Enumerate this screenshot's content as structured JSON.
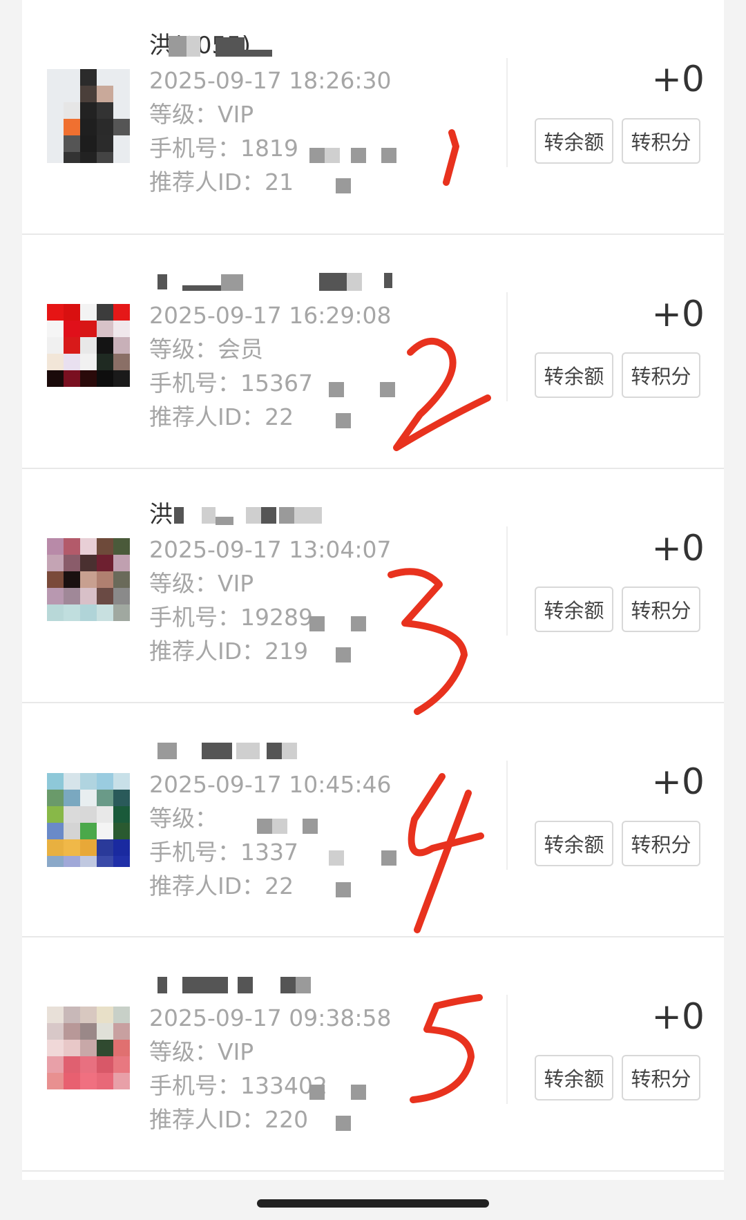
{
  "items": [
    {
      "name": "洪(0055)",
      "time": "2025-09-17 18:26:30",
      "level": "等级：VIP",
      "phone": "手机号：1819",
      "referrer": "推荐人ID：21",
      "amount": "+0",
      "btn_balance": "转余额",
      "btn_points": "转积分"
    },
    {
      "name": "",
      "time": "2025-09-17 16:29:08",
      "level": "等级：会员",
      "phone": "手机号：15367",
      "referrer": "推荐人ID：22",
      "amount": "+0",
      "btn_balance": "转余额",
      "btn_points": "转积分"
    },
    {
      "name": "洪",
      "time": "2025-09-17 13:04:07",
      "level": "等级：VIP",
      "phone": "手机号：19289",
      "referrer": "推荐人ID：219",
      "amount": "+0",
      "btn_balance": "转余额",
      "btn_points": "转积分"
    },
    {
      "name": "",
      "time": "2025-09-17 10:45:46",
      "level": "等级：",
      "phone": "手机号：1337",
      "referrer": "推荐人ID：22",
      "amount": "+0",
      "btn_balance": "转余额",
      "btn_points": "转积分"
    },
    {
      "name": "",
      "time": "2025-09-17 09:38:58",
      "level": "等级：VIP",
      "phone": "手机号：133402",
      "referrer": "推荐人ID：220",
      "amount": "+0",
      "btn_balance": "转余额",
      "btn_points": "转积分"
    }
  ],
  "annotations": [
    "1",
    "2",
    "3",
    "4",
    "5"
  ],
  "colors": {
    "annotation": "#e8321e",
    "text_primary": "#333333",
    "text_secondary": "#a6a6a6",
    "button_border": "#d8d8d8"
  }
}
